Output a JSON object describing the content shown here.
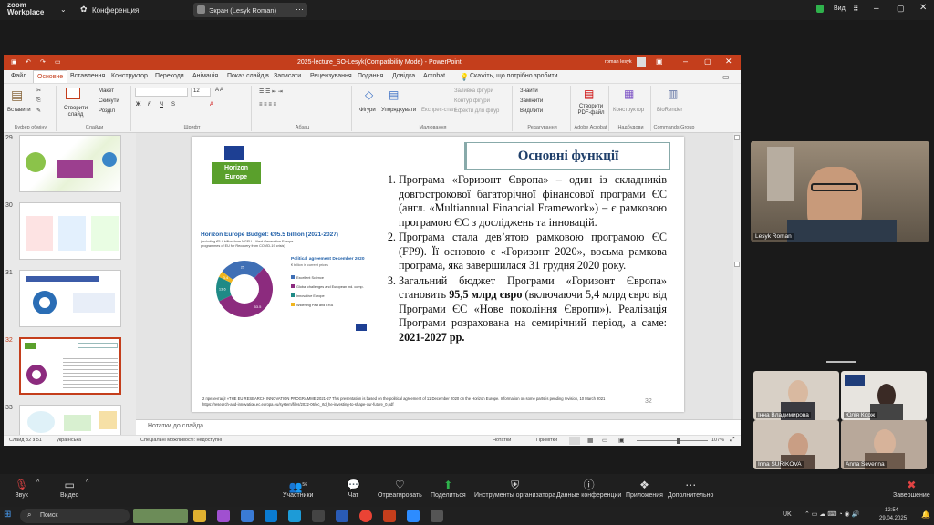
{
  "zoom_top": {
    "app_name": "zoom\nWorkplace",
    "app_name_line1": "zoom",
    "app_name_line2": "Workplace",
    "meeting_label": "Конференция",
    "screen_share_tab": "Экран (Lesyk Roman)",
    "view_label": "Вид"
  },
  "ppt": {
    "window_title": "2025-lecture_SO-Lesyk(Compatibility Mode)  -  PowerPoint",
    "user": "roman lesyk",
    "menu": [
      "Файл",
      "Основне",
      "Вставлення",
      "Конструктор",
      "Переходи",
      "Анімація",
      "Показ слайдів",
      "Записати",
      "Рецензування",
      "Подання",
      "Довідка",
      "Acrobat"
    ],
    "search_hint": "Скажіть, що потрібно зробити",
    "ribbon": {
      "paste": "Вставити",
      "clipboard": "Буфер обміну",
      "new_slide": "Створити слайд",
      "layout": "Макет",
      "reset": "Скинути",
      "section": "Розділ",
      "slides": "Слайди",
      "font": "Шрифт",
      "font_size": "12",
      "paragraph": "Абзац",
      "shapes": "Фігури",
      "arrange": "Упорядкувати",
      "quick_styles": "Експрес-стилі",
      "shape_fill": "Заливка фігури",
      "shape_outline": "Контур фігури",
      "shape_effects": "Ефекти для фігур",
      "drawing": "Малювання",
      "find": "Знайти",
      "replace": "Замінити",
      "select": "Виділити",
      "editing": "Редагування",
      "create_pdf": "Створити PDF-файл",
      "adobe": "Adobe Acrobat",
      "designer": "Конструктор",
      "viewer": "Надбудови",
      "bioreader": "BioRender",
      "commands": "Commands Group"
    },
    "thumb_numbers": [
      "29",
      "30",
      "31",
      "32",
      "33"
    ],
    "notes_placeholder": "Нотатки до слайда",
    "status": {
      "slide_counter": "Слайд 32 з 51",
      "language": "українська",
      "accessibility": "Спеціальні можливості: недоступні",
      "notes": "Нотатки",
      "comments": "Примітки",
      "zoom": "107%"
    }
  },
  "slide": {
    "logo_line1": "Horizon",
    "logo_line2": "Europe",
    "title": "Основні функції",
    "budget_title": "Horizon Europe Budget: €95.5 billion (2021-2027)",
    "budget_note": "(including €5.4 billion from NGEU – Next Generation Europe – programmes of EU for Recovery from COVID-19 crisis)",
    "political_title": "Political agreement December 2020",
    "political_sub": "€ billion in current prices",
    "legend": [
      "Excellent Science",
      "Global challenges and European ind. comp.",
      "Innovative Europe",
      "Widening Part and ERA"
    ],
    "items": [
      "Програма «Горизонт Європа» – один із складників довгострокової багаторічної фінансової програми ЄС (англ. «Multiannual Financial Framework») – є рамковою програмою ЄС з досліджень та інновацій.",
      "Програма стала дев’ятою рамковою програмою ЄС (FP9). Її основою є «Горизонт 2020», восьма рамкова програма, яка завершилася 31 грудня 2020 року."
    ],
    "item3_a": "Загальний бюджет Програми «Горизонт Європа» становить ",
    "item3_bold": "95,5 млрд євро",
    "item3_b": " (включаючи 5,4 млрд євро від Програми ЄС «Нове покоління Європи»). Реалізація Програми розрахована на семирічний період, а саме: ",
    "item3_bold2": "2021-2027 рр.",
    "footnote": "2 презентації «THE EU RESEARCH INNOVATION PROGRAMME 2021-27  This presentation is based on the political agreement of 11 December 2020 on the Horizon Europe. Information on some parts is pending revision, 10 March 2021 https://research-and-innovation.ec.europa.eu/system/files/2022-06/ec_rtd_he-investing-to-shape-our-future_0.pdf",
    "page_number": "32",
    "pie": [
      {
        "label": "Excellent Science",
        "value": 25.0,
        "color": "#3f6fb5"
      },
      {
        "label": "Global challenges",
        "value": 53.5,
        "color": "#8c2b7e"
      },
      {
        "label": "Innovative Europe",
        "value": 13.6,
        "color": "#1f8a86"
      },
      {
        "label": "Widening",
        "value": 3.4,
        "color": "#f0b51e"
      }
    ]
  },
  "participants": [
    {
      "name": "Lesyk Roman"
    },
    {
      "name": "Інна Владимирова"
    },
    {
      "name": "Юлія Корж"
    },
    {
      "name": "Inna SURIKOVA"
    },
    {
      "name": "Anna Severina"
    }
  ],
  "zoom_bottom": {
    "audio": "Звук",
    "video": "Видео",
    "participants": "Участники",
    "participants_count": "56",
    "chat": "Чат",
    "react": "Отреагировать",
    "share": "Поделиться",
    "host_tools": "Инструменты организатора",
    "meeting_info": "Данные конференции",
    "apps": "Приложения",
    "more": "Дополнительно",
    "end": "Завершение"
  },
  "taskbar": {
    "search": "Поиск",
    "lang": "UK",
    "time": "12:54",
    "date": "29.04.2025"
  }
}
